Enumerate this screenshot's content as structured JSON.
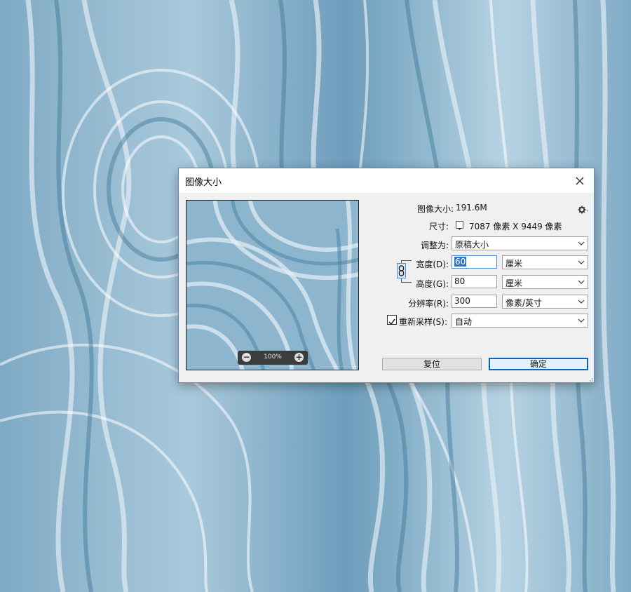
{
  "dialog": {
    "title": "图像大小",
    "close_icon": "close-icon",
    "preview": {
      "zoom": "100%"
    },
    "image_size": {
      "label": "图像大小:",
      "value": "191.6M"
    },
    "dimensions": {
      "label": "尺寸:",
      "value": "7087 像素  X  9449 像素"
    },
    "fit_to": {
      "label": "调整为:",
      "value": "原稿大小"
    },
    "width": {
      "label": "宽度(D):",
      "value": "60",
      "unit": "厘米"
    },
    "height": {
      "label": "高度(G):",
      "value": "80",
      "unit": "厘米"
    },
    "resolution": {
      "label": "分辨率(R):",
      "value": "300",
      "unit": "像素/英寸"
    },
    "resample": {
      "label": "重新采样(S):",
      "checked": true,
      "value": "自动"
    },
    "buttons": {
      "reset": "复位",
      "ok": "确定"
    }
  },
  "colors": {
    "accent": "#0a64c8",
    "wood_light": "#e3eef5",
    "wood_dark": "#4f87a8"
  }
}
